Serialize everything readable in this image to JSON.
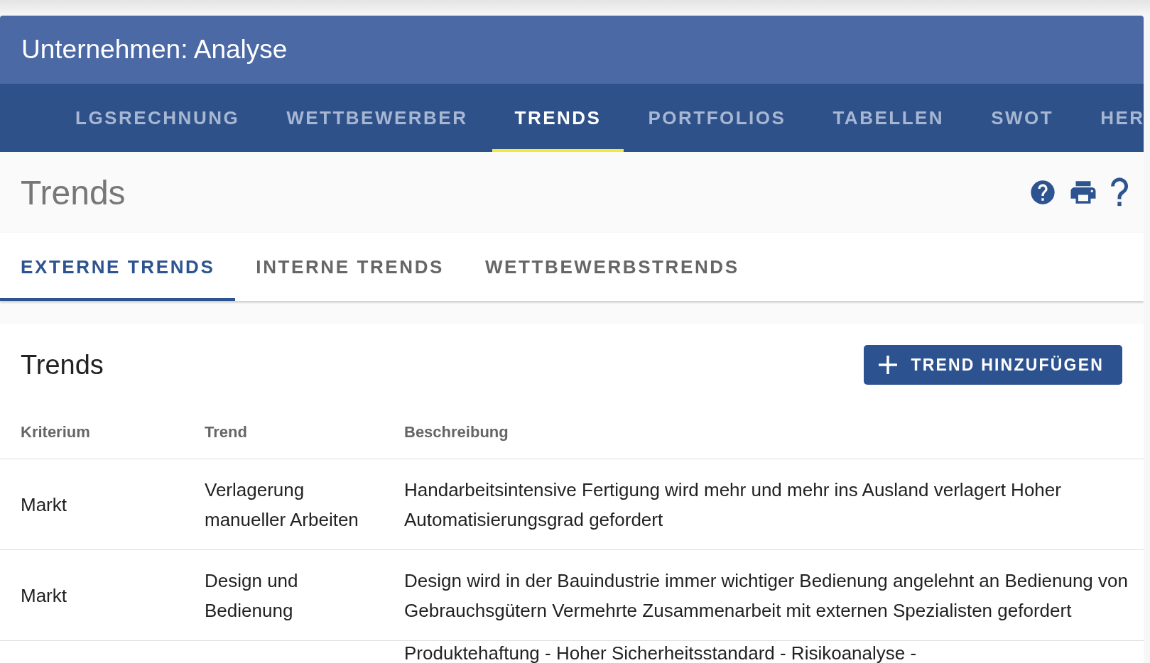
{
  "app_bar": {
    "title": "Unternehmen: Analyse"
  },
  "nav_tabs": [
    {
      "label": "LGSRECHNUNG",
      "selected": false
    },
    {
      "label": "WETTBEWERBER",
      "selected": false
    },
    {
      "label": "TRENDS",
      "selected": true
    },
    {
      "label": "PORTFOLIOS",
      "selected": false
    },
    {
      "label": "TABELLEN",
      "selected": false
    },
    {
      "label": "SWOT",
      "selected": false
    },
    {
      "label": "HER",
      "selected": false
    }
  ],
  "page": {
    "title": "Trends"
  },
  "sub_tabs": [
    {
      "label": "EXTERNE TRENDS",
      "selected": true
    },
    {
      "label": "INTERNE TRENDS",
      "selected": false
    },
    {
      "label": "WETTBEWERBSTRENDS",
      "selected": false
    }
  ],
  "card": {
    "title": "Trends",
    "add_button": "TREND HINZUFÜGEN"
  },
  "table": {
    "columns": [
      "Kriterium",
      "Trend",
      "Beschreibung"
    ],
    "rows": [
      {
        "kriterium": "Markt",
        "trend": "Verlagerung manueller Arbeiten",
        "beschreibung": "Handarbeitsintensive Fertigung wird mehr und mehr ins Ausland verlagert Hoher Automatisierungsgrad gefordert"
      },
      {
        "kriterium": "Markt",
        "trend": "Design und Bedienung",
        "beschreibung": "Design wird in der Bauindustrie immer wichtiger Bedienung angelehnt an Bedienung von Gebrauchsgütern Vermehrte Zusammenarbeit mit externen Spezialisten gefordert"
      },
      {
        "beschreibung": "Produktehaftung - Hoher Sicherheitsstandard - Risikoanalyse -"
      }
    ]
  }
}
